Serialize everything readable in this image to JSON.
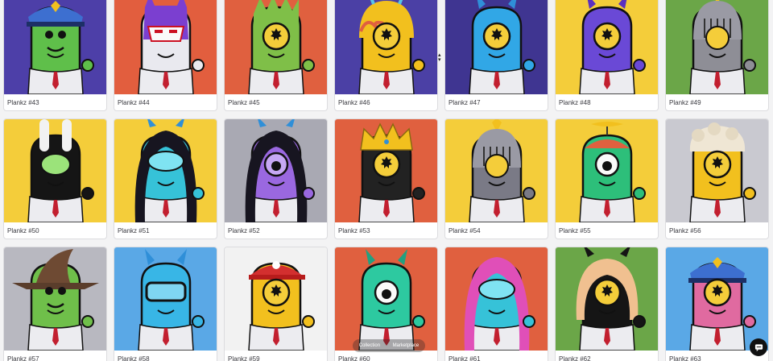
{
  "cards": [
    {
      "label": "Plankz #43",
      "bg": "#4d3fa8",
      "body": "#5fbf4a",
      "eye": "none",
      "hat": "cap-blue"
    },
    {
      "label": "Plankz #44",
      "bg": "#e25e3e",
      "body": "#e9e9ef",
      "eye": "mask",
      "hat": "hood-purple"
    },
    {
      "label": "Plankz #45",
      "bg": "#e0603f",
      "body": "#7fbf48",
      "eye": "yellow",
      "hat": "spiky-green"
    },
    {
      "label": "Plankz #46",
      "bg": "#4b40a5",
      "body": "#f2c01e",
      "eye": "yellow",
      "hat": "helmet-flame"
    },
    {
      "label": "Plankz #47",
      "bg": "#3f3591",
      "body": "#31a7e6",
      "eye": "yellow",
      "hat": "horns-blue"
    },
    {
      "label": "Plankz #48",
      "bg": "#f4cd3a",
      "body": "#6a49d6",
      "eye": "yellow",
      "hat": "horns-purple"
    },
    {
      "label": "Plankz #49",
      "bg": "#6ba648",
      "body": "#8e8e96",
      "eye": "cage",
      "hat": "knight"
    },
    {
      "label": "Plankz #50",
      "bg": "#f4cd3a",
      "body": "#151515",
      "eye": "green",
      "hat": "bunny"
    },
    {
      "label": "Plankz #51",
      "bg": "#f4cd3a",
      "body": "#36c2d8",
      "eye": "cyan",
      "hat": "hair-black"
    },
    {
      "label": "Plankz #52",
      "bg": "#a9a9b3",
      "body": "#9a68e0",
      "eye": "purple",
      "hat": "hair-black"
    },
    {
      "label": "Plankz #53",
      "bg": "#e0603f",
      "body": "#222222",
      "eye": "yellow",
      "hat": "crown"
    },
    {
      "label": "Plankz #54",
      "bg": "#f4cd3a",
      "body": "#7a7a86",
      "eye": "cage",
      "hat": "knight"
    },
    {
      "label": "Plankz #55",
      "bg": "#f4cd3a",
      "body": "#2dbf7a",
      "eye": "white",
      "hat": "propeller"
    },
    {
      "label": "Plankz #56",
      "bg": "#c9c9d0",
      "body": "#f2c01e",
      "eye": "yellow",
      "hat": "wool"
    },
    {
      "label": "Plankz #57",
      "bg": "#b8b8c0",
      "body": "#6fbf4a",
      "eye": "none",
      "hat": "witch"
    },
    {
      "label": "Plankz #58",
      "bg": "#5aa8e6",
      "body": "#38b6e6",
      "eye": "goggle",
      "hat": "horns-blue"
    },
    {
      "label": "Plankz #59",
      "bg": "#f2f2f2",
      "body": "#f2c01e",
      "eye": "yellow",
      "hat": "cap-red"
    },
    {
      "label": "Plankz #60",
      "bg": "#e0603f",
      "body": "#2dc9a0",
      "eye": "white",
      "hat": "horns-green"
    },
    {
      "label": "Plankz #61",
      "bg": "#e0603f",
      "body": "#36c2d8",
      "eye": "cyan",
      "hat": "hair-pink"
    },
    {
      "label": "Plankz #62",
      "bg": "#6ba648",
      "body": "#151515",
      "eye": "yellow",
      "hat": "hair-blonde"
    },
    {
      "label": "Plankz #63",
      "bg": "#5aa8e6",
      "body": "#e06aa0",
      "eye": "yellow",
      "hat": "cap-blue"
    }
  ],
  "pager": {
    "prev": "Collection",
    "next": "Marketplace"
  },
  "scroll_arrows": "⌃⌄",
  "icons": {
    "chat": "chat-bubble-icon"
  }
}
